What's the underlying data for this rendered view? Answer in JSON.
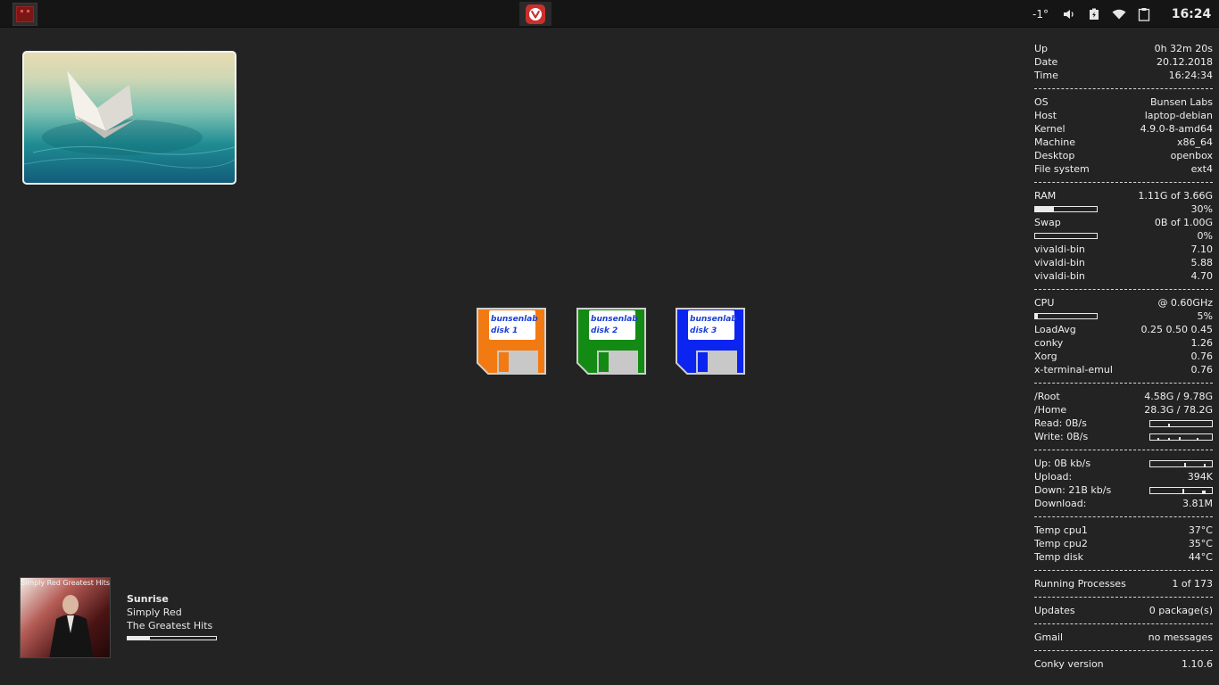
{
  "panel": {
    "taskbar_app_icon": "vivaldi-icon",
    "tray": {
      "temperature": "-1°",
      "volume_icon": "speaker-icon",
      "battery_icon": "battery-charging-icon",
      "wifi_icon": "wifi-icon",
      "clipboard_icon": "clipboard-icon",
      "clock": "16:24"
    }
  },
  "desktop": {
    "disks": [
      {
        "line1": "bunsenlab",
        "line2": "disk 1",
        "color": "#f27a12"
      },
      {
        "line1": "bunsenlab",
        "line2": "disk 2",
        "color": "#138a13"
      },
      {
        "line1": "bunsenlab",
        "line2": "disk 3",
        "color": "#0c24f0"
      }
    ]
  },
  "conky": {
    "uptime": {
      "label": "Up",
      "value": "0h 32m 20s"
    },
    "date": {
      "label": "Date",
      "value": "20.12.2018"
    },
    "time": {
      "label": "Time",
      "value": "16:24:34"
    },
    "system": [
      {
        "label": "OS",
        "value": "Bunsen Labs"
      },
      {
        "label": "Host",
        "value": "laptop-debian"
      },
      {
        "label": "Kernel",
        "value": "4.9.0-8-amd64"
      },
      {
        "label": "Machine",
        "value": "x86_64"
      },
      {
        "label": "Desktop",
        "value": "openbox"
      },
      {
        "label": "File system",
        "value": "ext4"
      }
    ],
    "ram": {
      "label": "RAM",
      "value": "1.11G of 3.66G",
      "percent_text": "30%",
      "percent": 30
    },
    "swap": {
      "label": "Swap",
      "value": "0B of 1.00G",
      "percent_text": "0%",
      "percent": 0
    },
    "mem_procs": [
      {
        "name": "vivaldi-bin",
        "value": "7.10"
      },
      {
        "name": "vivaldi-bin",
        "value": "5.88"
      },
      {
        "name": "vivaldi-bin",
        "value": "4.70"
      }
    ],
    "cpu": {
      "label": "CPU",
      "value": "@ 0.60GHz",
      "percent_text": "5%",
      "percent": 5
    },
    "loadavg": {
      "label": "LoadAvg",
      "value": "0.25 0.50 0.45"
    },
    "cpu_procs": [
      {
        "name": "conky",
        "value": "1.26"
      },
      {
        "name": "Xorg",
        "value": "0.76"
      },
      {
        "name": "x-terminal-emul",
        "value": "0.76"
      }
    ],
    "root": {
      "label": "/Root",
      "value": "4.58G / 9.78G"
    },
    "home": {
      "label": "/Home",
      "value": "28.3G / 78.2G"
    },
    "disk_read": {
      "label": "Read: 0B/s"
    },
    "disk_write": {
      "label": "Write: 0B/s"
    },
    "net_up": {
      "label": "Up: 0B kb/s"
    },
    "upload": {
      "label": "Upload:",
      "value": "394K"
    },
    "net_down": {
      "label": "Down: 21B kb/s"
    },
    "download": {
      "label": "Download:",
      "value": "3.81M"
    },
    "temps": [
      {
        "label": "Temp cpu1",
        "value": "37°C"
      },
      {
        "label": "Temp cpu2",
        "value": "35°C"
      },
      {
        "label": "Temp disk",
        "value": "44°C"
      }
    ],
    "processes": {
      "label": "Running Processes",
      "value": "1 of 173"
    },
    "updates": {
      "label": "Updates",
      "value": "0 package(s)"
    },
    "gmail": {
      "label": "Gmail",
      "value": "no messages"
    },
    "version": {
      "label": "Conky version",
      "value": "1.10.6"
    }
  },
  "music": {
    "album_label": "Simply Red Greatest Hits",
    "title": "Sunrise",
    "artist": "Simply Red",
    "album": "The Greatest Hits",
    "progress": 0.25
  }
}
